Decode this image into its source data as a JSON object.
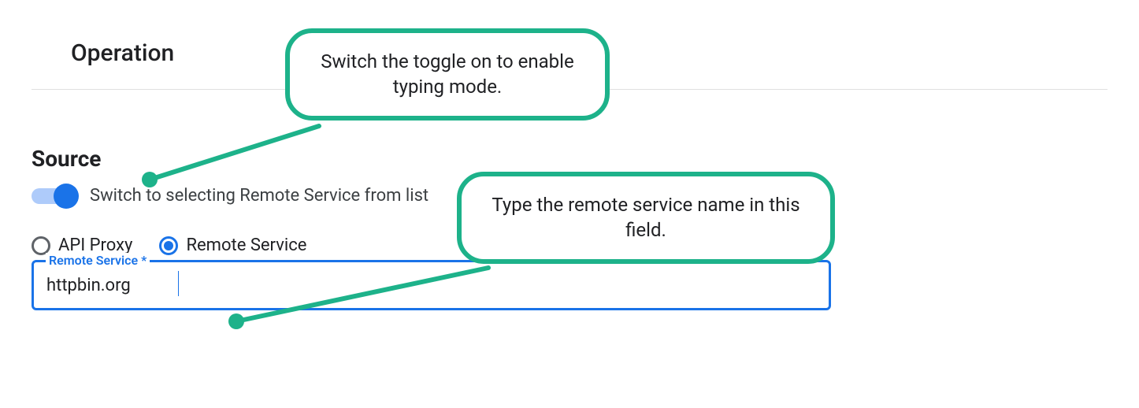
{
  "operation": {
    "title": "Operation"
  },
  "source": {
    "title": "Source",
    "toggle": {
      "label": "Switch to selecting Remote Service from list",
      "checked": true
    },
    "radios": {
      "api_proxy": "API Proxy",
      "remote_service": "Remote Service",
      "selected": "remote_service"
    },
    "input": {
      "label": "Remote Service *",
      "value": "httpbin.org"
    }
  },
  "annotations": {
    "callout1": "Switch the toggle on to enable typing mode.",
    "callout2": "Type the remote service name in this field."
  },
  "colors": {
    "accent_blue": "#1a73e8",
    "callout_teal": "#1db28a"
  }
}
